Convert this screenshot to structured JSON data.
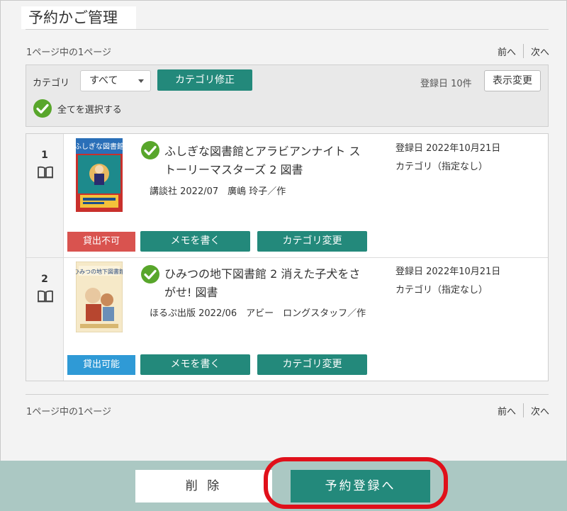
{
  "page": {
    "title": "予約かご管理"
  },
  "pager_top": {
    "info": "1ページ中の1ページ",
    "prev": "前へ",
    "next": "次へ"
  },
  "pager_bottom": {
    "info": "1ページ中の1ページ",
    "prev": "前へ",
    "next": "次へ"
  },
  "filter": {
    "category_label": "カテゴリ",
    "category_value": "すべて",
    "category_edit_button": "カテゴリ修正",
    "sort_info": "登録日 10件",
    "display_change_button": "表示変更",
    "select_all_label": "全てを選択する"
  },
  "items": [
    {
      "number": "1",
      "title_line1": "ふしぎな図書館とアラビアンナイト ス",
      "title_line2": "トーリーマスターズ 2 図書",
      "meta": "講談社 2022/07　廣嶋 玲子／作",
      "registered": "登録日 2022年10月21日",
      "category": "カテゴリ（指定なし）",
      "status": "貸出不可",
      "memo_button": "メモを書く",
      "category_change_button": "カテゴリ変更",
      "cover_text": "ふしぎな図書館"
    },
    {
      "number": "2",
      "title_line1": "ひみつの地下図書館 2 消えた子犬をさ",
      "title_line2": "がせ! 図書",
      "meta": "ほるぷ出版 2022/06　アビー　ロングスタッフ／作",
      "registered": "登録日 2022年10月21日",
      "category": "カテゴリ（指定なし）",
      "status": "貸出可能",
      "memo_button": "メモを書く",
      "category_change_button": "カテゴリ変更",
      "cover_text": "ひみつの地下図書館"
    }
  ],
  "footer": {
    "delete_button": "削 除",
    "reserve_button": "予約登録へ"
  },
  "colors": {
    "accent": "#23897b",
    "unavailable": "#d9534f",
    "available": "#2f9ad6",
    "check": "#58a62b",
    "highlight": "#e0101a"
  }
}
